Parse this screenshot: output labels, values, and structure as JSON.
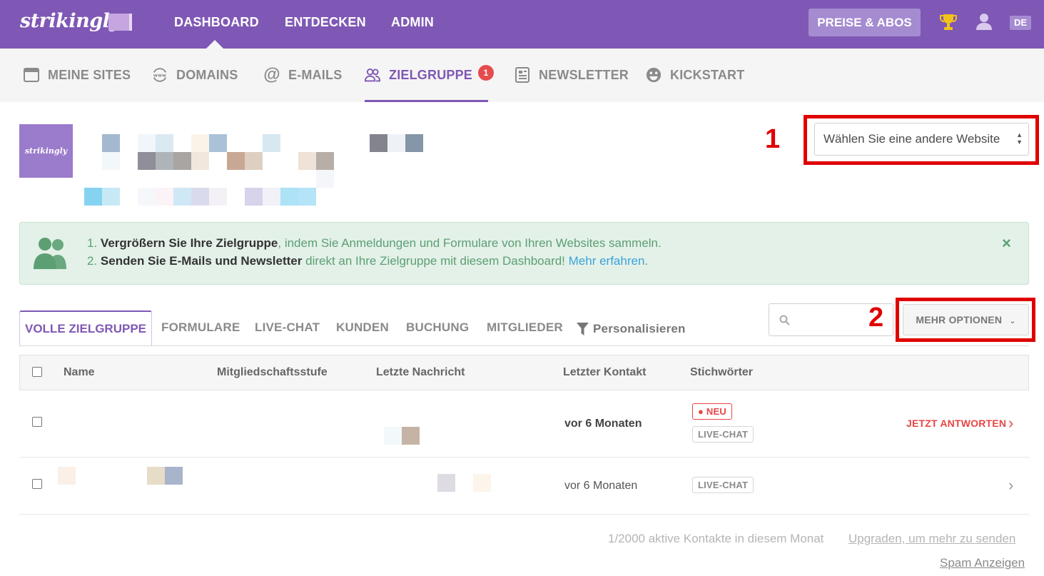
{
  "topnav": {
    "logo": "strikingly",
    "items": [
      "DASHBOARD",
      "ENTDECKEN",
      "ADMIN"
    ],
    "pricing_label": "PREISE & ABOS",
    "lang": "DE"
  },
  "subnav": {
    "items": [
      {
        "label": "MEINE SITES",
        "icon": "browser-window-icon"
      },
      {
        "label": "DOMAINS",
        "icon": "www-globe-icon"
      },
      {
        "label": "E-MAILS",
        "icon": "at-sign-icon"
      },
      {
        "label": "ZIELGRUPPE",
        "icon": "users-icon",
        "badge": "1",
        "active": true
      },
      {
        "label": "NEWSLETTER",
        "icon": "newsletter-icon"
      },
      {
        "label": "KICKSTART",
        "icon": "smiley-icon"
      }
    ]
  },
  "site": {
    "thumb_label": "strikingly",
    "select_label": "Wählen Sie eine andere Website"
  },
  "annotations": {
    "first": "1",
    "second": "2"
  },
  "banner": {
    "line1_num": "1.",
    "line1_bold": "Vergrößern Sie Ihre Zielgruppe",
    "line1_rest": ", indem Sie Anmeldungen und Formulare von Ihren Websites sammeln.",
    "line2_num": "2.",
    "line2_bold": "Senden Sie E-Mails und Newsletter",
    "line2_rest": " direkt an Ihre Zielgruppe mit diesem Dashboard! ",
    "line2_link": "Mehr erfahren",
    "line2_end": ".",
    "close": "×"
  },
  "tabs": {
    "active": "VOLLE ZIELGRUPPE",
    "items": [
      "FORMULARE",
      "LIVE-CHAT",
      "KUNDEN",
      "BUCHUNG",
      "MITGLIEDER"
    ],
    "personalize": "Personalisieren",
    "more_options": "MEHR OPTIONEN"
  },
  "table": {
    "columns": [
      "Name",
      "Mitgliedschaftsstufe",
      "Letzte Nachricht",
      "Letzter Kontakt",
      "Stichwörter"
    ],
    "rows": [
      {
        "last_contact": "vor 6 Monaten",
        "tag_new": "● NEU",
        "tag": "LIVE-CHAT",
        "action": "JETZT ANTWORTEN"
      },
      {
        "last_contact": "vor 6 Monaten",
        "tag": "LIVE-CHAT"
      }
    ]
  },
  "footer": {
    "quota": "1/2000 aktive Kontakte in diesem Monat",
    "upgrade": "Upgraden, um mehr zu senden",
    "spam": "Spam Anzeigen"
  },
  "colors": {
    "brand": "#7f58b5",
    "alert": "#e84545",
    "annotation": "#e00000"
  }
}
